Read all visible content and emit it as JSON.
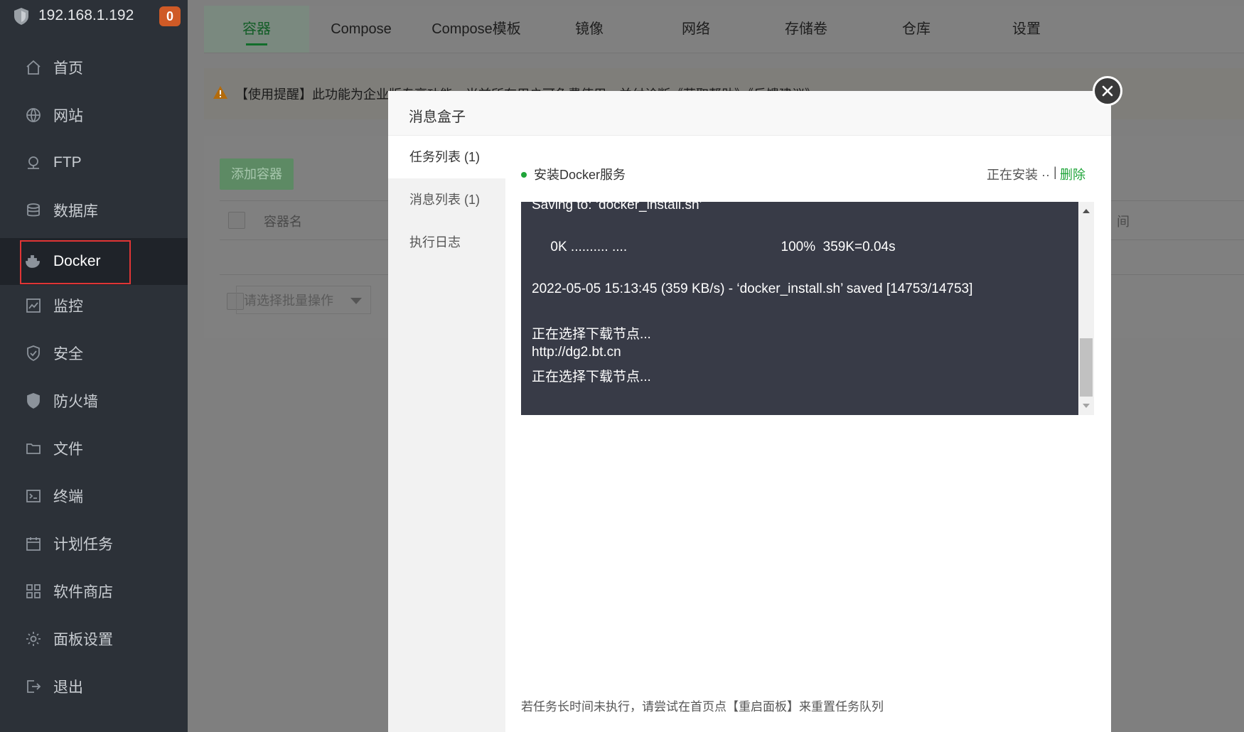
{
  "sidebar": {
    "server_ip": "192.168.1.192",
    "badge_count": "0",
    "items": [
      {
        "label": "首页",
        "icon": "home-icon"
      },
      {
        "label": "网站",
        "icon": "globe-icon"
      },
      {
        "label": "FTP",
        "icon": "ftp-icon"
      },
      {
        "label": "数据库",
        "icon": "database-icon"
      },
      {
        "label": "Docker",
        "icon": "docker-icon",
        "active": true
      },
      {
        "label": "监控",
        "icon": "monitor-icon"
      },
      {
        "label": "安全",
        "icon": "shield-check-icon"
      },
      {
        "label": "防火墙",
        "icon": "firewall-icon"
      },
      {
        "label": "文件",
        "icon": "folder-icon"
      },
      {
        "label": "终端",
        "icon": "terminal-icon"
      },
      {
        "label": "计划任务",
        "icon": "calendar-icon"
      },
      {
        "label": "软件商店",
        "icon": "apps-grid-icon"
      },
      {
        "label": "面板设置",
        "icon": "gear-icon"
      },
      {
        "label": "退出",
        "icon": "logout-icon"
      }
    ]
  },
  "tabs": [
    "容器",
    "Compose",
    "Compose模板",
    "镜像",
    "网络",
    "存储卷",
    "仓库",
    "设置"
  ],
  "notice": {
    "text": "【使用提醒】此功能为企业版专享功能，当前所有用户可免费使用，并付诊断《获取帮助》《反馈建议》"
  },
  "panel": {
    "add_button": "添加容器",
    "col_name": "容器名",
    "col_time_fragment": "间",
    "batch_placeholder": "请选择批量操作"
  },
  "modal": {
    "title": "消息盒子",
    "tabs": [
      "任务列表 (1)",
      "消息列表 (1)",
      "执行日志"
    ],
    "task_name": "安装Docker服务",
    "task_status": "正在安装 ··",
    "delete_label": "删除",
    "separator": "|",
    "console_lines": [
      "Saving to: ‘docker_install.sh’",
      "     0K .......... ....                                         100%  359K=0.04s",
      "2022-05-05 15:13:45 (359 KB/s) - ‘docker_install.sh’ saved [14753/14753]",
      "正在选择下载节点...",
      "http://dg2.bt.cn",
      "正在选择下载节点..."
    ],
    "hint": "若任务长时间未执行，请尝试在首页点【重启面板】来重置任务队列"
  },
  "colors": {
    "accent": "#20a53a",
    "sidebar_bg": "#2c3138",
    "badge": "#cf5a26",
    "highlight_box": "#e03535"
  }
}
